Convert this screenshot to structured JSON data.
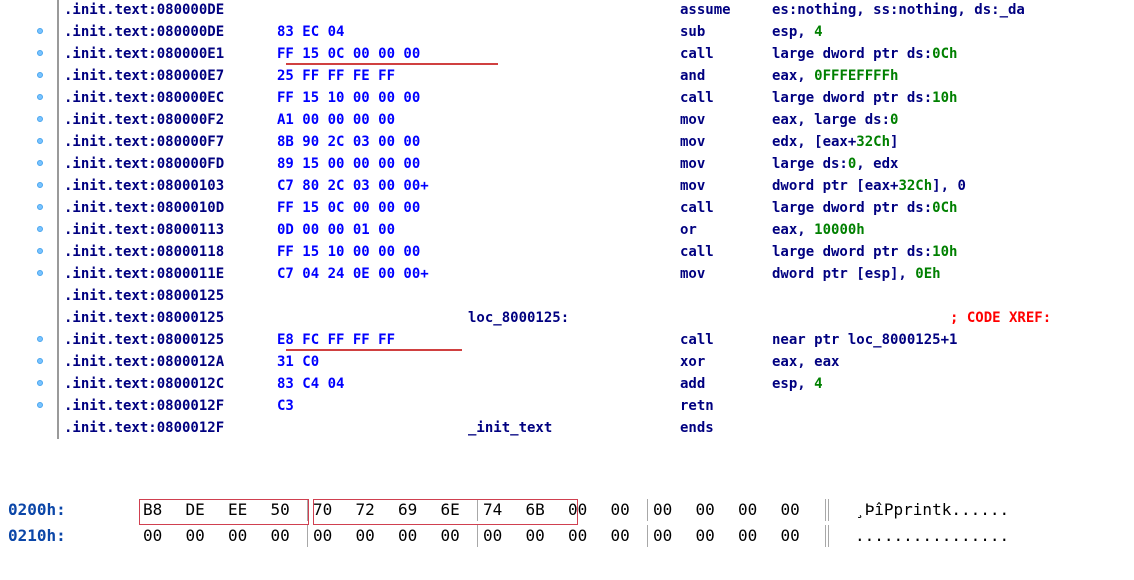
{
  "disassembly": {
    "rows": [
      {
        "addr": ".init.text:080000DE",
        "bytes": "",
        "label": "",
        "mnemonic": "assume",
        "operands": "es:nothing, ss:nothing, ds:_da",
        "dot": false
      },
      {
        "addr": ".init.text:080000DE",
        "bytes": "83 EC 04",
        "label": "",
        "mnemonic": "sub",
        "operands": "esp, ",
        "num": "4",
        "dot": true
      },
      {
        "addr": ".init.text:080000E1",
        "bytes": "FF 15 0C 00 00 00",
        "label": "",
        "mnemonic": "call",
        "operands": "large dword ptr ds:",
        "num": "0Ch",
        "dot": true,
        "underline": true
      },
      {
        "addr": ".init.text:080000E7",
        "bytes": "25 FF FF FE FF",
        "label": "",
        "mnemonic": "and",
        "operands": "eax, ",
        "num": "0FFFEFFFFh",
        "dot": true
      },
      {
        "addr": ".init.text:080000EC",
        "bytes": "FF 15 10 00 00 00",
        "label": "",
        "mnemonic": "call",
        "operands": "large dword ptr ds:",
        "num": "10h",
        "dot": true
      },
      {
        "addr": ".init.text:080000F2",
        "bytes": "A1 00 00 00 00",
        "label": "",
        "mnemonic": "mov",
        "operands": "eax, large ds:",
        "num": "0",
        "dot": true
      },
      {
        "addr": ".init.text:080000F7",
        "bytes": "8B 90 2C 03 00 00",
        "label": "",
        "mnemonic": "mov",
        "operands": "edx, [eax+",
        "num": "32Ch",
        "tail": "]",
        "dot": true
      },
      {
        "addr": ".init.text:080000FD",
        "bytes": "89 15 00 00 00 00",
        "label": "",
        "mnemonic": "mov",
        "operands": "large ds:",
        "num": "0",
        "tail": ", edx",
        "dot": true
      },
      {
        "addr": ".init.text:08000103",
        "bytes": "C7 80 2C 03 00 00+",
        "label": "",
        "mnemonic": "mov",
        "operands": "dword ptr [eax+",
        "num": "32Ch",
        "tail": "], 0",
        "dot": true
      },
      {
        "addr": ".init.text:0800010D",
        "bytes": "FF 15 0C 00 00 00",
        "label": "",
        "mnemonic": "call",
        "operands": "large dword ptr ds:",
        "num": "0Ch",
        "dot": true
      },
      {
        "addr": ".init.text:08000113",
        "bytes": "0D 00 00 01 00",
        "label": "",
        "mnemonic": "or",
        "operands": "eax, ",
        "num": "10000h",
        "dot": true
      },
      {
        "addr": ".init.text:08000118",
        "bytes": "FF 15 10 00 00 00",
        "label": "",
        "mnemonic": "call",
        "operands": "large dword ptr ds:",
        "num": "10h",
        "dot": true
      },
      {
        "addr": ".init.text:0800011E",
        "bytes": "C7 04 24 0E 00 00+",
        "label": "",
        "mnemonic": "mov",
        "operands": "dword ptr [esp], ",
        "num": "0Eh",
        "dot": true
      },
      {
        "addr": ".init.text:08000125",
        "bytes": "",
        "label": "",
        "mnemonic": "",
        "operands": "",
        "dot": false
      },
      {
        "addr": ".init.text:08000125",
        "bytes": "",
        "label": "loc_8000125:",
        "mnemonic": "",
        "operands": "",
        "comment": "; CODE XREF:",
        "dot": false
      },
      {
        "addr": ".init.text:08000125",
        "bytes": "E8 FC FF FF FF",
        "label": "",
        "mnemonic": "call",
        "operands": "near ptr loc_8000125+1",
        "dot": true,
        "underline": true
      },
      {
        "addr": ".init.text:0800012A",
        "bytes": "31 C0",
        "label": "",
        "mnemonic": "xor",
        "operands": "eax, eax",
        "dot": true
      },
      {
        "addr": ".init.text:0800012C",
        "bytes": "83 C4 04",
        "label": "",
        "mnemonic": "add",
        "operands": "esp, ",
        "num": "4",
        "dot": true
      },
      {
        "addr": ".init.text:0800012F",
        "bytes": "C3",
        "label": "",
        "mnemonic": "retn",
        "operands": "",
        "dot": true
      },
      {
        "addr": ".init.text:0800012F",
        "bytes": "",
        "label": "_init_text",
        "mnemonic": "ends",
        "operands": "",
        "dot": false
      }
    ]
  },
  "hex_view": {
    "rows": [
      {
        "offset": "0200h:",
        "bytes": [
          "B8",
          "DE",
          "EE",
          "50",
          "70",
          "72",
          "69",
          "6E",
          "74",
          "6B",
          "00",
          "00",
          "00",
          "00",
          "00",
          "00"
        ],
        "ascii": "¸ÞîPprintk......"
      },
      {
        "offset": "0210h:",
        "bytes": [
          "00",
          "00",
          "00",
          "00",
          "00",
          "00",
          "00",
          "00",
          "00",
          "00",
          "00",
          "00",
          "00",
          "00",
          "00",
          "00"
        ],
        "ascii": "................"
      }
    ]
  },
  "colors": {
    "address": "#000080",
    "bytes": "#0000ff",
    "number": "#008000",
    "comment": "#ff0000",
    "highlight_box": "#d04050",
    "hex_offset": "#0b46a8"
  }
}
